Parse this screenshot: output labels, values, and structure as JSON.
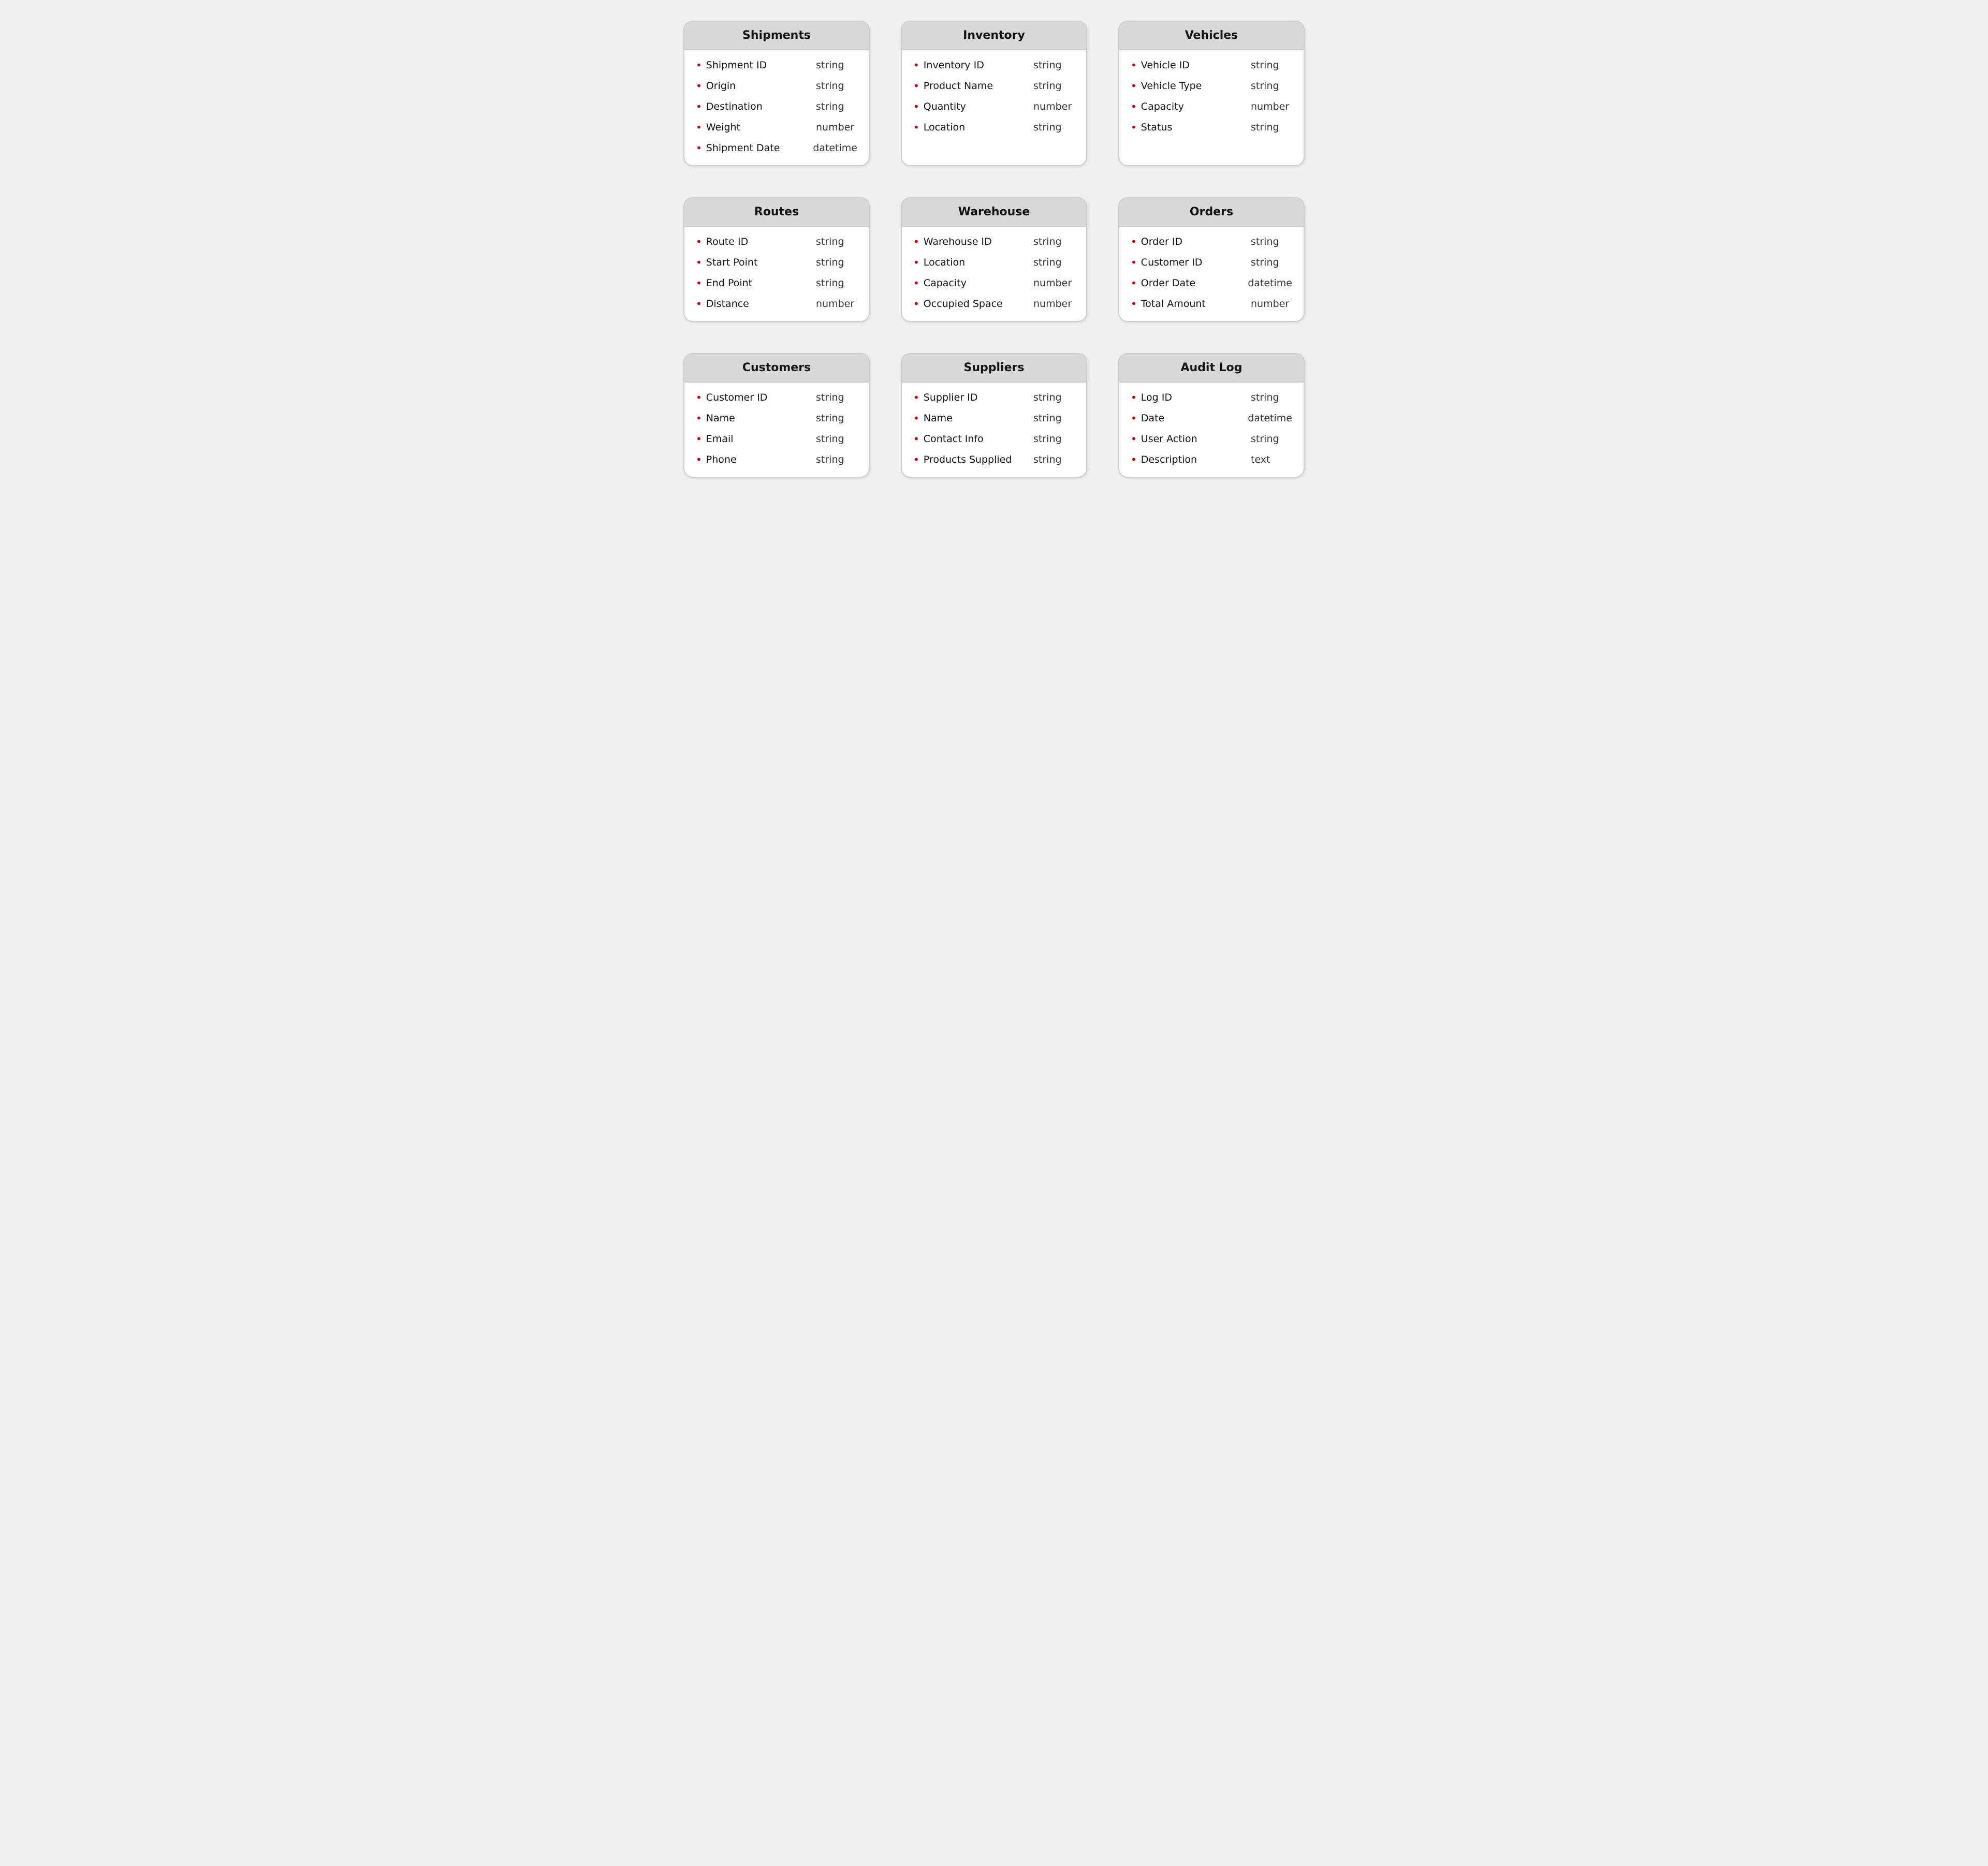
{
  "cards": [
    {
      "id": "shipments",
      "title": "Shipments",
      "fields": [
        {
          "name": "Shipment ID",
          "type": "string"
        },
        {
          "name": "Origin",
          "type": "string"
        },
        {
          "name": "Destination",
          "type": "string"
        },
        {
          "name": "Weight",
          "type": "number"
        },
        {
          "name": "Shipment Date",
          "type": "datetime"
        }
      ]
    },
    {
      "id": "inventory",
      "title": "Inventory",
      "fields": [
        {
          "name": "Inventory ID",
          "type": "string"
        },
        {
          "name": "Product Name",
          "type": "string"
        },
        {
          "name": "Quantity",
          "type": "number"
        },
        {
          "name": "Location",
          "type": "string"
        }
      ]
    },
    {
      "id": "vehicles",
      "title": "Vehicles",
      "fields": [
        {
          "name": "Vehicle ID",
          "type": "string"
        },
        {
          "name": "Vehicle Type",
          "type": "string"
        },
        {
          "name": "Capacity",
          "type": "number"
        },
        {
          "name": "Status",
          "type": "string"
        }
      ]
    },
    {
      "id": "routes",
      "title": "Routes",
      "fields": [
        {
          "name": "Route ID",
          "type": "string"
        },
        {
          "name": "Start Point",
          "type": "string"
        },
        {
          "name": "End Point",
          "type": "string"
        },
        {
          "name": "Distance",
          "type": "number"
        }
      ]
    },
    {
      "id": "warehouse",
      "title": "Warehouse",
      "fields": [
        {
          "name": "Warehouse ID",
          "type": "string"
        },
        {
          "name": "Location",
          "type": "string"
        },
        {
          "name": "Capacity",
          "type": "number"
        },
        {
          "name": "Occupied Space",
          "type": "number"
        }
      ]
    },
    {
      "id": "orders",
      "title": "Orders",
      "fields": [
        {
          "name": "Order ID",
          "type": "string"
        },
        {
          "name": "Customer ID",
          "type": "string"
        },
        {
          "name": "Order Date",
          "type": "datetime"
        },
        {
          "name": "Total Amount",
          "type": "number"
        }
      ]
    },
    {
      "id": "customers",
      "title": "Customers",
      "fields": [
        {
          "name": "Customer ID",
          "type": "string"
        },
        {
          "name": "Name",
          "type": "string"
        },
        {
          "name": "Email",
          "type": "string"
        },
        {
          "name": "Phone",
          "type": "string"
        }
      ]
    },
    {
      "id": "suppliers",
      "title": "Suppliers",
      "fields": [
        {
          "name": "Supplier ID",
          "type": "string"
        },
        {
          "name": "Name",
          "type": "string"
        },
        {
          "name": "Contact Info",
          "type": "string"
        },
        {
          "name": "Products Supplied",
          "type": "string"
        }
      ]
    },
    {
      "id": "audit-log",
      "title": "Audit Log",
      "fields": [
        {
          "name": "Log ID",
          "type": "string"
        },
        {
          "name": "Date",
          "type": "datetime"
        },
        {
          "name": "User Action",
          "type": "string"
        },
        {
          "name": "Description",
          "type": "text"
        }
      ]
    }
  ]
}
